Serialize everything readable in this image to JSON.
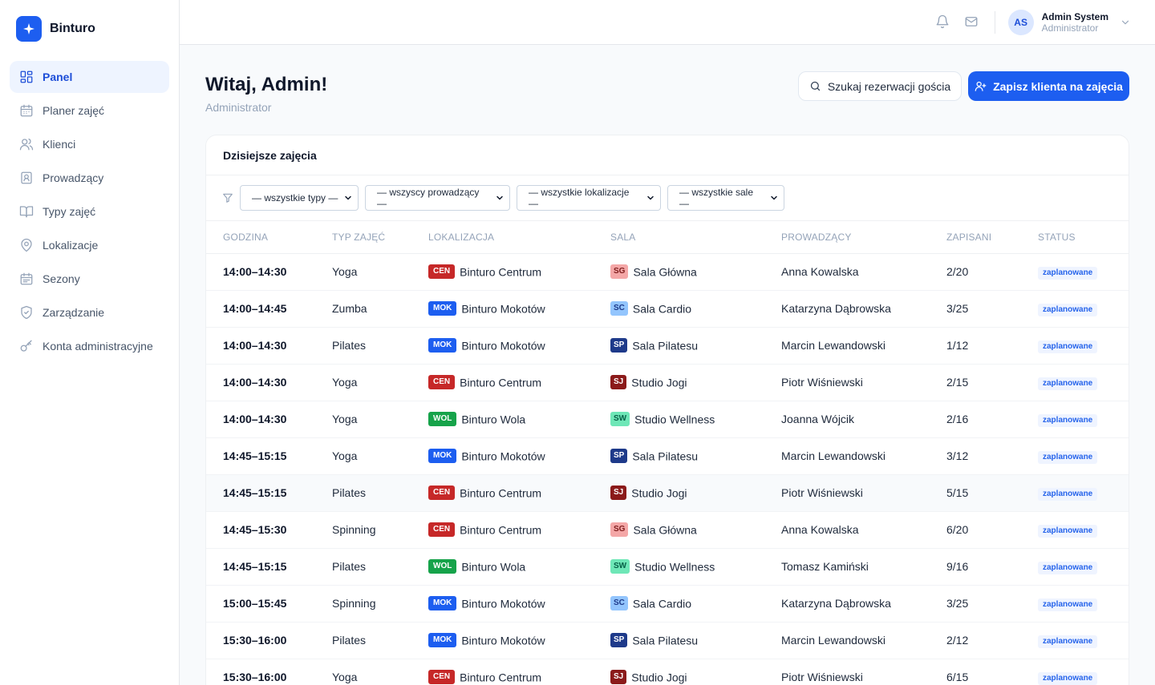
{
  "brand": {
    "name": "Binturo",
    "logo_color": "#1d5ef0"
  },
  "sidebar": {
    "items": [
      {
        "label": "Panel",
        "icon": "layout-grid-icon",
        "active": true
      },
      {
        "label": "Planer zajęć",
        "icon": "calendar-icon"
      },
      {
        "label": "Klienci",
        "icon": "users-icon"
      },
      {
        "label": "Prowadzący",
        "icon": "contact-icon"
      },
      {
        "label": "Typy zajęć",
        "icon": "book-open-icon"
      },
      {
        "label": "Lokalizacje",
        "icon": "map-pin-icon"
      },
      {
        "label": "Sezony",
        "icon": "calendar-range-icon"
      },
      {
        "label": "Zarządzanie",
        "icon": "shield-icon"
      },
      {
        "label": "Konta administracyjne",
        "icon": "key-icon"
      }
    ]
  },
  "topbar": {
    "user_initials": "AS",
    "user_name": "Admin System",
    "user_role": "Administrator"
  },
  "header": {
    "title": "Witaj, Admin!",
    "subtitle": "Administrator",
    "search_button": "Szukaj rezerwacji gościa",
    "primary_button": "Zapisz klienta na zajęcia"
  },
  "card": {
    "title": "Dzisiejsze zajęcia",
    "filters": [
      "— wszystkie typy —",
      "— wszyscy prowadzący —",
      "— wszystkie lokalizacje —",
      "— wszystkie sale —"
    ],
    "columns": [
      "Godzina",
      "Typ zajęć",
      "Lokalizacja",
      "Sala",
      "Prowadzący",
      "Zapisani",
      "Status"
    ],
    "rows": [
      {
        "time": "14:00–14:30",
        "type": "Yoga",
        "loc_code": "CEN",
        "loc": "Binturo Centrum",
        "room_code": "SG",
        "room": "Sala Główna",
        "trainer": "Anna Kowalska",
        "enrolled": "2/20",
        "status": "zaplanowane"
      },
      {
        "time": "14:00–14:45",
        "type": "Zumba",
        "loc_code": "MOK",
        "loc": "Binturo Mokotów",
        "room_code": "SC",
        "room": "Sala Cardio",
        "trainer": "Katarzyna Dąbrowska",
        "enrolled": "3/25",
        "status": "zaplanowane"
      },
      {
        "time": "14:00–14:30",
        "type": "Pilates",
        "loc_code": "MOK",
        "loc": "Binturo Mokotów",
        "room_code": "SP",
        "room": "Sala Pilatesu",
        "trainer": "Marcin Lewandowski",
        "enrolled": "1/12",
        "status": "zaplanowane"
      },
      {
        "time": "14:00–14:30",
        "type": "Yoga",
        "loc_code": "CEN",
        "loc": "Binturo Centrum",
        "room_code": "SJ",
        "room": "Studio Jogi",
        "trainer": "Piotr Wiśniewski",
        "enrolled": "2/15",
        "status": "zaplanowane"
      },
      {
        "time": "14:00–14:30",
        "type": "Yoga",
        "loc_code": "WOL",
        "loc": "Binturo Wola",
        "room_code": "SW",
        "room": "Studio Wellness",
        "trainer": "Joanna Wójcik",
        "enrolled": "2/16",
        "status": "zaplanowane"
      },
      {
        "time": "14:45–15:15",
        "type": "Yoga",
        "loc_code": "MOK",
        "loc": "Binturo Mokotów",
        "room_code": "SP",
        "room": "Sala Pilatesu",
        "trainer": "Marcin Lewandowski",
        "enrolled": "3/12",
        "status": "zaplanowane"
      },
      {
        "time": "14:45–15:15",
        "type": "Pilates",
        "loc_code": "CEN",
        "loc": "Binturo Centrum",
        "room_code": "SJ",
        "room": "Studio Jogi",
        "trainer": "Piotr Wiśniewski",
        "enrolled": "5/15",
        "status": "zaplanowane"
      },
      {
        "time": "14:45–15:30",
        "type": "Spinning",
        "loc_code": "CEN",
        "loc": "Binturo Centrum",
        "room_code": "SG",
        "room": "Sala Główna",
        "trainer": "Anna Kowalska",
        "enrolled": "6/20",
        "status": "zaplanowane"
      },
      {
        "time": "14:45–15:15",
        "type": "Pilates",
        "loc_code": "WOL",
        "loc": "Binturo Wola",
        "room_code": "SW",
        "room": "Studio Wellness",
        "trainer": "Tomasz Kamiński",
        "enrolled": "9/16",
        "status": "zaplanowane"
      },
      {
        "time": "15:00–15:45",
        "type": "Spinning",
        "loc_code": "MOK",
        "loc": "Binturo Mokotów",
        "room_code": "SC",
        "room": "Sala Cardio",
        "trainer": "Katarzyna Dąbrowska",
        "enrolled": "3/25",
        "status": "zaplanowane"
      },
      {
        "time": "15:30–16:00",
        "type": "Pilates",
        "loc_code": "MOK",
        "loc": "Binturo Mokotów",
        "room_code": "SP",
        "room": "Sala Pilatesu",
        "trainer": "Marcin Lewandowski",
        "enrolled": "2/12",
        "status": "zaplanowane"
      },
      {
        "time": "15:30–16:00",
        "type": "Yoga",
        "loc_code": "CEN",
        "loc": "Binturo Centrum",
        "room_code": "SJ",
        "room": "Studio Jogi",
        "trainer": "Piotr Wiśniewski",
        "enrolled": "6/15",
        "status": "zaplanowane"
      }
    ]
  },
  "colors": {
    "accent": "#1d5ef0",
    "loc_CEN": "#c62828",
    "loc_MOK": "#1d5ef0",
    "loc_WOL": "#16a34a",
    "room_SG": "#f4a7a7",
    "room_SC": "#93c5fd",
    "room_SP": "#1e3a8a",
    "room_SJ": "#8b1a1a",
    "room_SW": "#6ee7b7"
  }
}
